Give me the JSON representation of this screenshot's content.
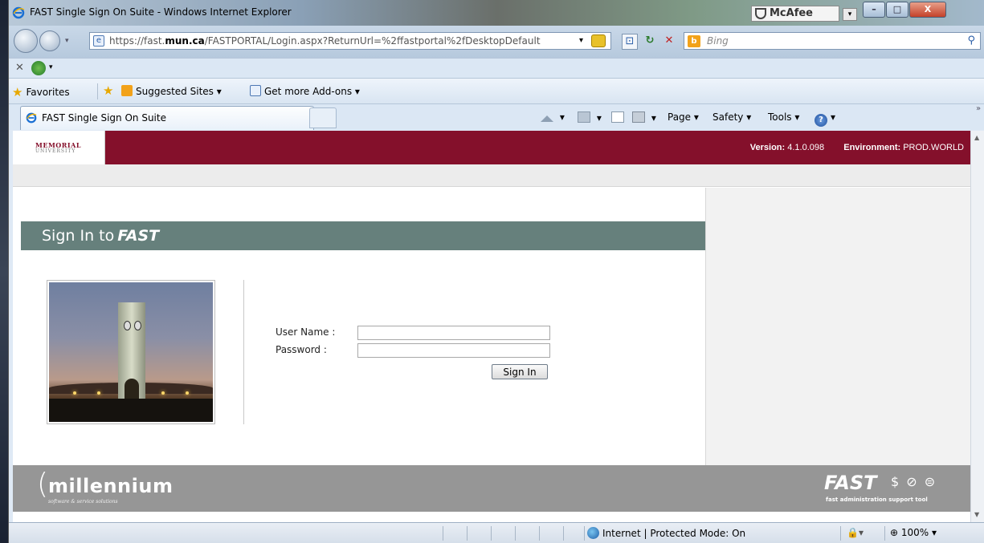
{
  "window": {
    "title": "FAST Single Sign On Suite - Windows Internet Explorer",
    "mcafee": "McAfee",
    "min": "–",
    "max": "□",
    "close": "X"
  },
  "addressbar": {
    "url_prefix": "https://fast.",
    "url_domain": "mun.ca",
    "url_rest": "/FASTPORTAL/Login.aspx?ReturnUrl=%2ffastportal%2fDesktopDefault",
    "search_placeholder": "Bing"
  },
  "favorites": {
    "favorites_label": "Favorites",
    "suggested_label": "Suggested Sites ▾",
    "addons_label": "Get more Add-ons ▾"
  },
  "tab": {
    "label": "FAST Single Sign On Suite"
  },
  "commandbar": {
    "page": "Page ▾",
    "safety": "Safety ▾",
    "tools": "Tools ▾",
    "more": "»"
  },
  "banner": {
    "logo_line1": "MEMORIAL",
    "logo_line2": "UNIVERSITY",
    "version_label": "Version:",
    "version_value": "4.1.0.098",
    "env_label": "Environment:",
    "env_value": "PROD.WORLD"
  },
  "signin": {
    "heading_prefix": "Sign In to",
    "heading_brand": "FAST",
    "username_label": "User Name :",
    "password_label": "Password :",
    "username_value": "",
    "password_value": "",
    "button": "Sign In"
  },
  "footer": {
    "brand": "millennium",
    "tagline": "software & service solutions",
    "fast": "FAST",
    "fast_icons": "$ ⊘ ⊜",
    "fast_tagline": "fast administration support tool"
  },
  "statusbar": {
    "zone": "Internet | Protected Mode: On",
    "zoom": "100%",
    "security_icon": "🔒▾"
  }
}
